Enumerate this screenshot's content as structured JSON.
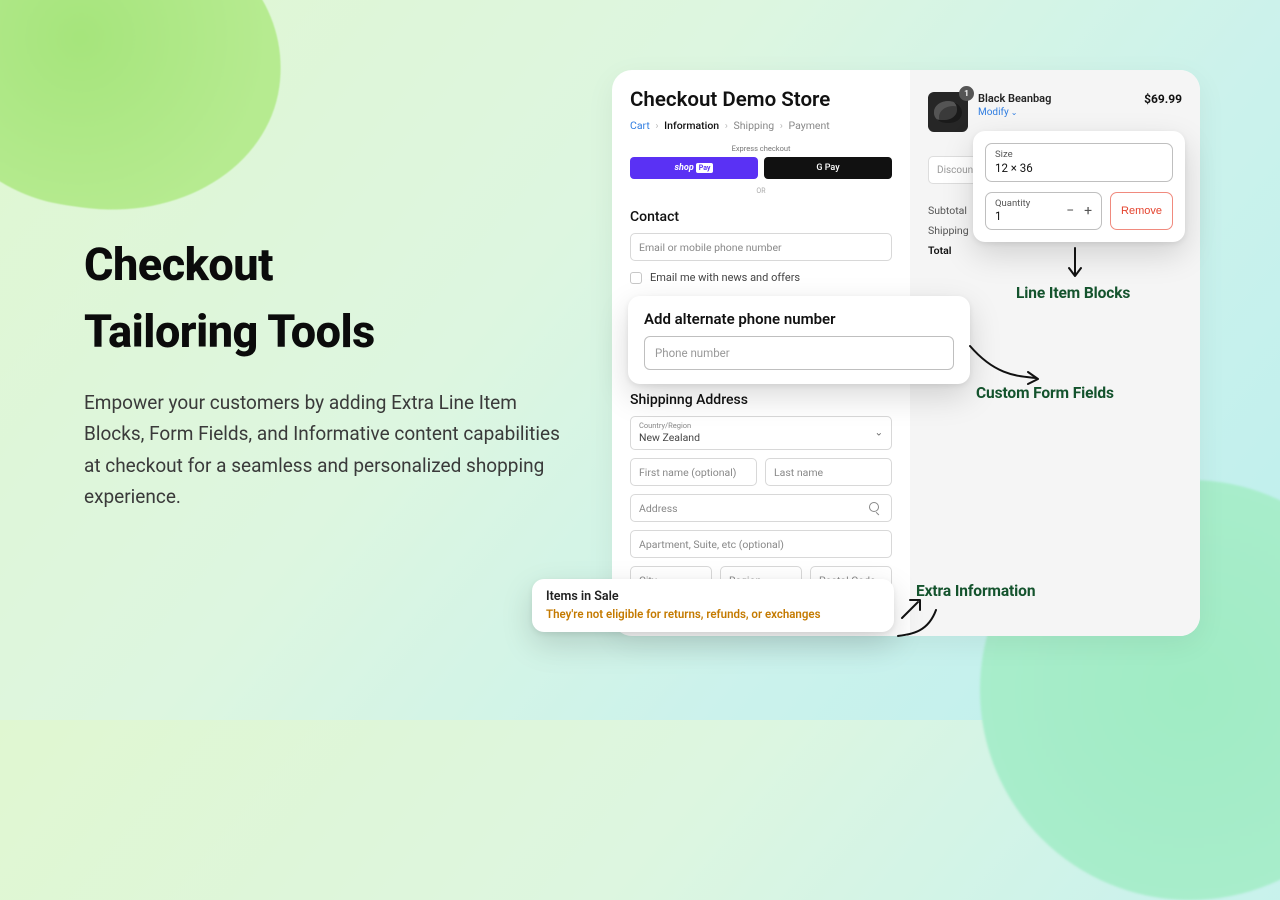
{
  "hero": {
    "title_line1": "Checkout",
    "title_line2": "Tailoring Tools",
    "subtitle": "Empower your customers by adding Extra Line Item Blocks, Form Fields, and Informative content capabilities at checkout for a seamless and personalized shopping experience."
  },
  "checkout": {
    "store_title": "Checkout Demo Store",
    "crumbs": {
      "cart": "Cart",
      "information": "Information",
      "shipping": "Shipping",
      "payment": "Payment"
    },
    "express_label": "Express checkout",
    "shop_pay_prefix": "shop",
    "shop_pay_badge": "Pay",
    "gpay_label": "G Pay",
    "or": "OR",
    "contact_heading": "Contact",
    "email_placeholder": "Email or mobile phone number",
    "news_checkbox": "Email me with news and offers",
    "shipping_heading": "Shippinng Address",
    "country_label": "Country/Region",
    "country_value": "New Zealand",
    "first_name_placeholder": "First name (optional)",
    "last_name_placeholder": "Last name",
    "address_placeholder": "Address",
    "apt_placeholder": "Apartment, Suite, etc (optional)",
    "city_placeholder": "City",
    "region_placeholder": "Region",
    "postal_placeholder": "Postal Code"
  },
  "summary": {
    "badge": "1",
    "product_name": "Black Beanbag",
    "modify_label": "Modify",
    "price": "$69.99",
    "discount_placeholder": "Discount",
    "subtotal_label": "Subtotal",
    "shipping_label": "Shipping",
    "total_label": "Total"
  },
  "callouts": {
    "alt_phone": {
      "heading": "Add alternate phone number",
      "placeholder": "Phone number"
    },
    "line_item": {
      "size_label": "Size",
      "size_value": "12 × 36",
      "qty_label": "Quantity",
      "qty_value": "1",
      "remove": "Remove"
    },
    "sale": {
      "heading": "Items in Sale",
      "body": "They're not eligible for returns, refunds, or exchanges"
    }
  },
  "annotations": {
    "line_item_blocks": "Line Item Blocks",
    "custom_form_fields": "Custom Form Fields",
    "extra_information": "Extra Information"
  }
}
